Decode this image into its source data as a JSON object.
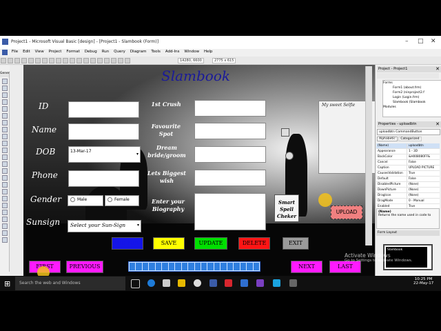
{
  "window": {
    "title": "Project1 - Microsoft Visual Basic [design] - [Project1 - Slambook (Form)]"
  },
  "menu": [
    "File",
    "Edit",
    "View",
    "Project",
    "Format",
    "Debug",
    "Run",
    "Query",
    "Diagram",
    "Tools",
    "Add-Ins",
    "Window",
    "Help"
  ],
  "toolbar": {
    "position": "14280, 6600",
    "size": "2775 x 615"
  },
  "toolbox": {
    "header": "General"
  },
  "form": {
    "title": "Slambook",
    "labels": {
      "id": "ID",
      "name": "Name",
      "dob": "DOB",
      "phone": "Phone",
      "gender": "Gender",
      "sunsign": "Sunsign",
      "crush": "1st Crush",
      "spot": "Favourite Spot",
      "dream": "Dream bride/groom",
      "wish": "Lets Biggest wish",
      "bio": "Enter your Biography"
    },
    "dob_value": "13-Mar-17",
    "gender_male": "Male",
    "gender_female": "Female",
    "sunsign_placeholder": "Select your Sun-Sign",
    "selfie_label": "My sweet Selfie",
    "spell_label": "Smart Spell Cheker",
    "upload": "UPLOAD",
    "buttons": {
      "add": "ADD NEW",
      "save": "SAVE",
      "update": "UPDATE",
      "delete": "DELETE",
      "exit": "EXIT",
      "first": "FIRST",
      "previous": "PREVIOUS",
      "next": "NEXT",
      "last": "LAST"
    },
    "colors": {
      "add": "#1515e8",
      "save": "#ffff00",
      "update": "#00e000",
      "delete": "#ff1515",
      "exit": "#9a9a9a",
      "nav": "#ff1aff",
      "upload": "#f08080"
    }
  },
  "project": {
    "header": "Project - Project1",
    "tree": [
      "Forms",
      "Form1 (about.frm)",
      "Form2 (ninproject2.f",
      "Login (Login.frm)",
      "Slambook (Slambook",
      "Modules"
    ]
  },
  "properties": {
    "header": "Properties - uploadbtn",
    "object": "uploadbtn CommandButton",
    "tabs": [
      "Alphabetic",
      "Categorized"
    ],
    "rows": [
      [
        "(Name)",
        "uploadbtn"
      ],
      [
        "Appearance",
        "1 - 3D"
      ],
      [
        "BackColor",
        "&H008080FF&"
      ],
      [
        "Cancel",
        "False"
      ],
      [
        "Caption",
        "UPLOAD PICTURE"
      ],
      [
        "CausesValidation",
        "True"
      ],
      [
        "Default",
        "False"
      ],
      [
        "DisabledPicture",
        "(None)"
      ],
      [
        "DownPicture",
        "(None)"
      ],
      [
        "DragIcon",
        "(None)"
      ],
      [
        "DragMode",
        "0 - Manual"
      ],
      [
        "Enabled",
        "True"
      ],
      [
        "Font",
        "Corbel"
      ]
    ],
    "desc_title": "(Name)",
    "desc_text": "Returns the name used in code to"
  },
  "layout": {
    "header": "Form Layout",
    "form_name": "Slambook"
  },
  "watermark": {
    "title": "Activate Windows",
    "sub": "Go to Settings to activate Windows."
  },
  "taskbar": {
    "search": "Search the web and Windows",
    "time": "10:25 PM",
    "date": "22-May-17"
  }
}
